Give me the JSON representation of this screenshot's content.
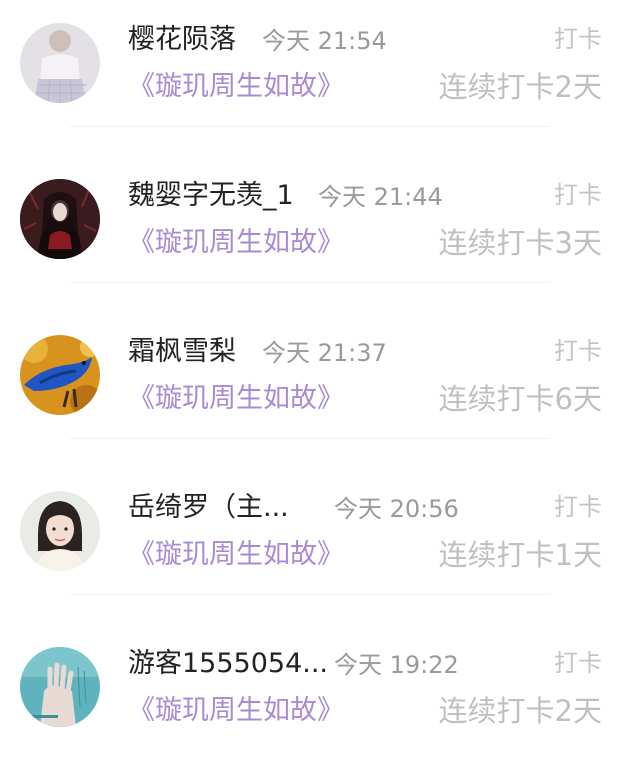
{
  "checkins": [
    {
      "user": "樱花陨落",
      "time": "今天 21:54",
      "action": "打卡",
      "book": "《璇玑周生如故》",
      "streak": "连续打卡2天",
      "avatar": "avatar-girl-in-dress"
    },
    {
      "user": "魏婴字无羡_1",
      "time": "今天 21:44",
      "action": "打卡",
      "book": "《璇玑周生如故》",
      "streak": "连续打卡3天",
      "avatar": "avatar-dark-anime-figure"
    },
    {
      "user": "霜枫雪梨",
      "time": "今天 21:37",
      "action": "打卡",
      "book": "《璇玑周生如故》",
      "streak": "连续打卡6天",
      "avatar": "avatar-blue-bird"
    },
    {
      "user": "岳绮罗（主...",
      "time": "今天 20:56",
      "action": "打卡",
      "book": "《璇玑周生如故》",
      "streak": "连续打卡1天",
      "avatar": "avatar-woman-portrait"
    },
    {
      "user": "游客1555054...",
      "time": "今天 19:22",
      "action": "打卡",
      "book": "《璇玑周生如故》",
      "streak": "连续打卡2天",
      "avatar": "avatar-teal-hand"
    }
  ],
  "colors": {
    "username": "#222222",
    "time": "#9a9a9a",
    "action": "#c4c4c4",
    "book": "#a98bd4",
    "streak": "#c0c0c0"
  }
}
